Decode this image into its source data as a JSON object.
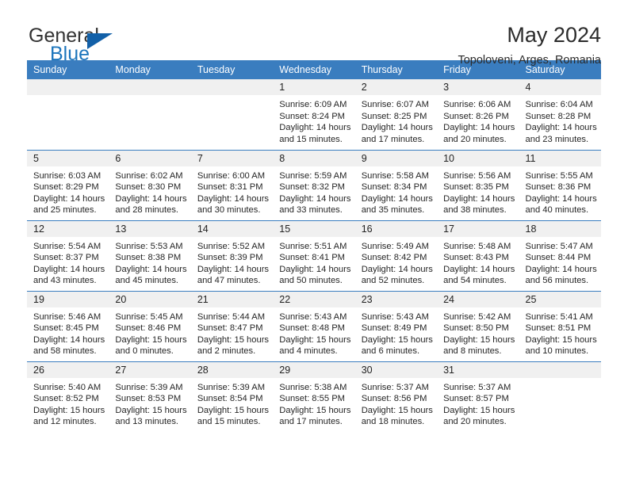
{
  "brand": {
    "name_line1": "General",
    "name_line2": "Blue",
    "triangle_color": "#1260a8",
    "blue_color": "#1c75bc"
  },
  "header": {
    "title": "May 2024",
    "subtitle": "Topoloveni, Arges, Romania"
  },
  "theme": {
    "header_bg": "#3a7dbf",
    "daynum_bg": "#f0f0f0",
    "rule_color": "#3a7dbf"
  },
  "weekdays": [
    "Sunday",
    "Monday",
    "Tuesday",
    "Wednesday",
    "Thursday",
    "Friday",
    "Saturday"
  ],
  "weeks": [
    [
      {
        "day": "",
        "blank": true
      },
      {
        "day": "",
        "blank": true
      },
      {
        "day": "",
        "blank": true
      },
      {
        "day": "1",
        "sunrise": "Sunrise: 6:09 AM",
        "sunset": "Sunset: 8:24 PM",
        "daylight1": "Daylight: 14 hours",
        "daylight2": "and 15 minutes."
      },
      {
        "day": "2",
        "sunrise": "Sunrise: 6:07 AM",
        "sunset": "Sunset: 8:25 PM",
        "daylight1": "Daylight: 14 hours",
        "daylight2": "and 17 minutes."
      },
      {
        "day": "3",
        "sunrise": "Sunrise: 6:06 AM",
        "sunset": "Sunset: 8:26 PM",
        "daylight1": "Daylight: 14 hours",
        "daylight2": "and 20 minutes."
      },
      {
        "day": "4",
        "sunrise": "Sunrise: 6:04 AM",
        "sunset": "Sunset: 8:28 PM",
        "daylight1": "Daylight: 14 hours",
        "daylight2": "and 23 minutes."
      }
    ],
    [
      {
        "day": "5",
        "sunrise": "Sunrise: 6:03 AM",
        "sunset": "Sunset: 8:29 PM",
        "daylight1": "Daylight: 14 hours",
        "daylight2": "and 25 minutes."
      },
      {
        "day": "6",
        "sunrise": "Sunrise: 6:02 AM",
        "sunset": "Sunset: 8:30 PM",
        "daylight1": "Daylight: 14 hours",
        "daylight2": "and 28 minutes."
      },
      {
        "day": "7",
        "sunrise": "Sunrise: 6:00 AM",
        "sunset": "Sunset: 8:31 PM",
        "daylight1": "Daylight: 14 hours",
        "daylight2": "and 30 minutes."
      },
      {
        "day": "8",
        "sunrise": "Sunrise: 5:59 AM",
        "sunset": "Sunset: 8:32 PM",
        "daylight1": "Daylight: 14 hours",
        "daylight2": "and 33 minutes."
      },
      {
        "day": "9",
        "sunrise": "Sunrise: 5:58 AM",
        "sunset": "Sunset: 8:34 PM",
        "daylight1": "Daylight: 14 hours",
        "daylight2": "and 35 minutes."
      },
      {
        "day": "10",
        "sunrise": "Sunrise: 5:56 AM",
        "sunset": "Sunset: 8:35 PM",
        "daylight1": "Daylight: 14 hours",
        "daylight2": "and 38 minutes."
      },
      {
        "day": "11",
        "sunrise": "Sunrise: 5:55 AM",
        "sunset": "Sunset: 8:36 PM",
        "daylight1": "Daylight: 14 hours",
        "daylight2": "and 40 minutes."
      }
    ],
    [
      {
        "day": "12",
        "sunrise": "Sunrise: 5:54 AM",
        "sunset": "Sunset: 8:37 PM",
        "daylight1": "Daylight: 14 hours",
        "daylight2": "and 43 minutes."
      },
      {
        "day": "13",
        "sunrise": "Sunrise: 5:53 AM",
        "sunset": "Sunset: 8:38 PM",
        "daylight1": "Daylight: 14 hours",
        "daylight2": "and 45 minutes."
      },
      {
        "day": "14",
        "sunrise": "Sunrise: 5:52 AM",
        "sunset": "Sunset: 8:39 PM",
        "daylight1": "Daylight: 14 hours",
        "daylight2": "and 47 minutes."
      },
      {
        "day": "15",
        "sunrise": "Sunrise: 5:51 AM",
        "sunset": "Sunset: 8:41 PM",
        "daylight1": "Daylight: 14 hours",
        "daylight2": "and 50 minutes."
      },
      {
        "day": "16",
        "sunrise": "Sunrise: 5:49 AM",
        "sunset": "Sunset: 8:42 PM",
        "daylight1": "Daylight: 14 hours",
        "daylight2": "and 52 minutes."
      },
      {
        "day": "17",
        "sunrise": "Sunrise: 5:48 AM",
        "sunset": "Sunset: 8:43 PM",
        "daylight1": "Daylight: 14 hours",
        "daylight2": "and 54 minutes."
      },
      {
        "day": "18",
        "sunrise": "Sunrise: 5:47 AM",
        "sunset": "Sunset: 8:44 PM",
        "daylight1": "Daylight: 14 hours",
        "daylight2": "and 56 minutes."
      }
    ],
    [
      {
        "day": "19",
        "sunrise": "Sunrise: 5:46 AM",
        "sunset": "Sunset: 8:45 PM",
        "daylight1": "Daylight: 14 hours",
        "daylight2": "and 58 minutes."
      },
      {
        "day": "20",
        "sunrise": "Sunrise: 5:45 AM",
        "sunset": "Sunset: 8:46 PM",
        "daylight1": "Daylight: 15 hours",
        "daylight2": "and 0 minutes."
      },
      {
        "day": "21",
        "sunrise": "Sunrise: 5:44 AM",
        "sunset": "Sunset: 8:47 PM",
        "daylight1": "Daylight: 15 hours",
        "daylight2": "and 2 minutes."
      },
      {
        "day": "22",
        "sunrise": "Sunrise: 5:43 AM",
        "sunset": "Sunset: 8:48 PM",
        "daylight1": "Daylight: 15 hours",
        "daylight2": "and 4 minutes."
      },
      {
        "day": "23",
        "sunrise": "Sunrise: 5:43 AM",
        "sunset": "Sunset: 8:49 PM",
        "daylight1": "Daylight: 15 hours",
        "daylight2": "and 6 minutes."
      },
      {
        "day": "24",
        "sunrise": "Sunrise: 5:42 AM",
        "sunset": "Sunset: 8:50 PM",
        "daylight1": "Daylight: 15 hours",
        "daylight2": "and 8 minutes."
      },
      {
        "day": "25",
        "sunrise": "Sunrise: 5:41 AM",
        "sunset": "Sunset: 8:51 PM",
        "daylight1": "Daylight: 15 hours",
        "daylight2": "and 10 minutes."
      }
    ],
    [
      {
        "day": "26",
        "sunrise": "Sunrise: 5:40 AM",
        "sunset": "Sunset: 8:52 PM",
        "daylight1": "Daylight: 15 hours",
        "daylight2": "and 12 minutes."
      },
      {
        "day": "27",
        "sunrise": "Sunrise: 5:39 AM",
        "sunset": "Sunset: 8:53 PM",
        "daylight1": "Daylight: 15 hours",
        "daylight2": "and 13 minutes."
      },
      {
        "day": "28",
        "sunrise": "Sunrise: 5:39 AM",
        "sunset": "Sunset: 8:54 PM",
        "daylight1": "Daylight: 15 hours",
        "daylight2": "and 15 minutes."
      },
      {
        "day": "29",
        "sunrise": "Sunrise: 5:38 AM",
        "sunset": "Sunset: 8:55 PM",
        "daylight1": "Daylight: 15 hours",
        "daylight2": "and 17 minutes."
      },
      {
        "day": "30",
        "sunrise": "Sunrise: 5:37 AM",
        "sunset": "Sunset: 8:56 PM",
        "daylight1": "Daylight: 15 hours",
        "daylight2": "and 18 minutes."
      },
      {
        "day": "31",
        "sunrise": "Sunrise: 5:37 AM",
        "sunset": "Sunset: 8:57 PM",
        "daylight1": "Daylight: 15 hours",
        "daylight2": "and 20 minutes."
      },
      {
        "day": "",
        "blank": true
      }
    ]
  ]
}
